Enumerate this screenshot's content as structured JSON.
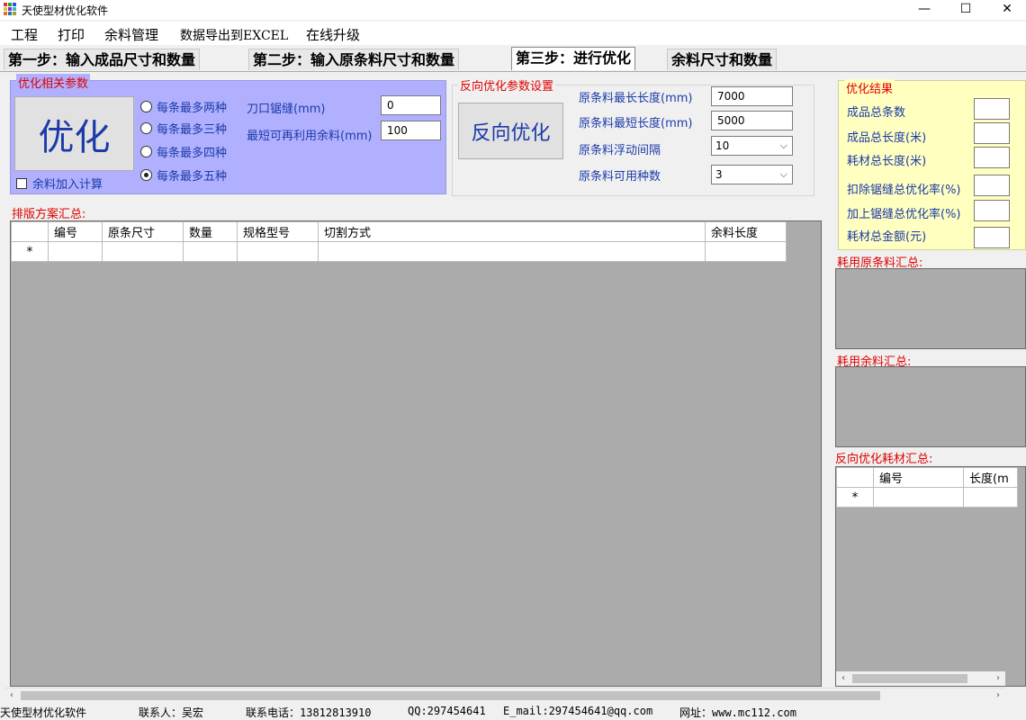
{
  "window": {
    "title": "天使型材优化软件",
    "minimize": "—",
    "maximize": "☐",
    "close": "✕"
  },
  "menu": [
    "工程",
    "打印",
    "余料管理",
    "数据导出到EXCEL",
    "在线升级"
  ],
  "tabs": [
    "第一步：输入成品尺寸和数量",
    "第二步：输入原条料尺寸和数量",
    "第三步：进行优化",
    "余料尺寸和数量"
  ],
  "active_tab": 2,
  "optimize_group": {
    "title": "优化相关参数",
    "button": "优化",
    "radios": [
      {
        "label": "每条最多两种",
        "checked": false
      },
      {
        "label": "每条最多三种",
        "checked": false
      },
      {
        "label": "每条最多四种",
        "checked": false
      },
      {
        "label": "每条最多五种",
        "checked": true
      }
    ],
    "kerf_label": "刀口锯缝(mm)",
    "kerf_value": "0",
    "min_remnant_label": "最短可再利用余料(mm)",
    "min_remnant_value": "100",
    "include_remnant_label": "余料加入计算"
  },
  "reverse_group": {
    "title": "反向优化参数设置",
    "button": "反向优化",
    "max_len_label": "原条料最长长度(mm)",
    "max_len_value": "7000",
    "min_len_label": "原条料最短长度(mm)",
    "min_len_value": "5000",
    "interval_label": "原条料浮动间隔",
    "interval_value": "10",
    "kinds_label": "原条料可用种数",
    "kinds_value": "3"
  },
  "layout_summary": {
    "title": "排版方案汇总:",
    "columns": [
      "编号",
      "原条尺寸",
      "数量",
      "规格型号",
      "切割方式",
      "余料长度"
    ],
    "new_row_marker": "*"
  },
  "results": {
    "title": "优化结果",
    "labels": [
      "成品总条数",
      "成品总长度(米)",
      "耗材总长度(米)",
      "扣除锯缝总优化率(%)",
      "加上锯缝总优化率(%)",
      "耗材总金额(元)"
    ]
  },
  "raw_usage_title": "耗用原条料汇总:",
  "remnant_usage_title": "耗用余料汇总:",
  "reverse_usage": {
    "title": "反向优化耗材汇总:",
    "columns": [
      "编号",
      "长度(m"
    ],
    "new_row_marker": "*"
  },
  "status": {
    "app": "天使型材优化软件",
    "contact": "联系人：吴宏",
    "phone": "联系电话：13812813910",
    "qq": "QQ:297454641",
    "email": "E_mail:297454641@qq.com",
    "website": "网址：www.mc112.com"
  }
}
